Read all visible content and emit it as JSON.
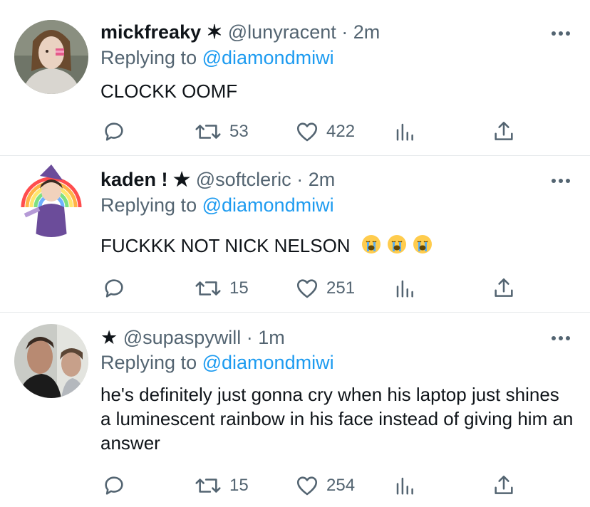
{
  "tweets": [
    {
      "display_name": "mickfreaky ✶",
      "handle": "@lunyracent",
      "separator": "·",
      "time": "2m",
      "replying_prefix": "Replying to",
      "replying_to": "@diamondmiwi",
      "text": "CLOCKK OOMF",
      "emojis": [],
      "retweets": "53",
      "likes": "422"
    },
    {
      "display_name": "kaden ! ★",
      "handle": "@softcleric",
      "separator": "·",
      "time": "2m",
      "replying_prefix": "Replying to",
      "replying_to": "@diamondmiwi",
      "text": "FUCKKK NOT NICK NELSON",
      "emojis": [
        "loudly-crying-face",
        "loudly-crying-face",
        "loudly-crying-face"
      ],
      "retweets": "15",
      "likes": "251"
    },
    {
      "display_name": "★",
      "handle": "@supaspywill",
      "separator": "·",
      "time": "1m",
      "replying_prefix": "Replying to",
      "replying_to": "@diamondmiwi",
      "text": "he's definitely just gonna cry when his laptop just shines a luminescent rainbow in his face instead of giving him an answer",
      "emojis": [],
      "retweets": "15",
      "likes": "254"
    }
  ],
  "icons": {
    "more": "more-horizontal-icon",
    "reply": "reply-icon",
    "retweet": "retweet-icon",
    "like": "heart-icon",
    "analytics": "analytics-icon",
    "share": "share-icon",
    "emoji": "loudly-crying-face-emoji"
  },
  "colors": {
    "text": "#0f1419",
    "muted": "#536471",
    "link": "#1d9bf0",
    "divider": "#e6e9eb"
  }
}
